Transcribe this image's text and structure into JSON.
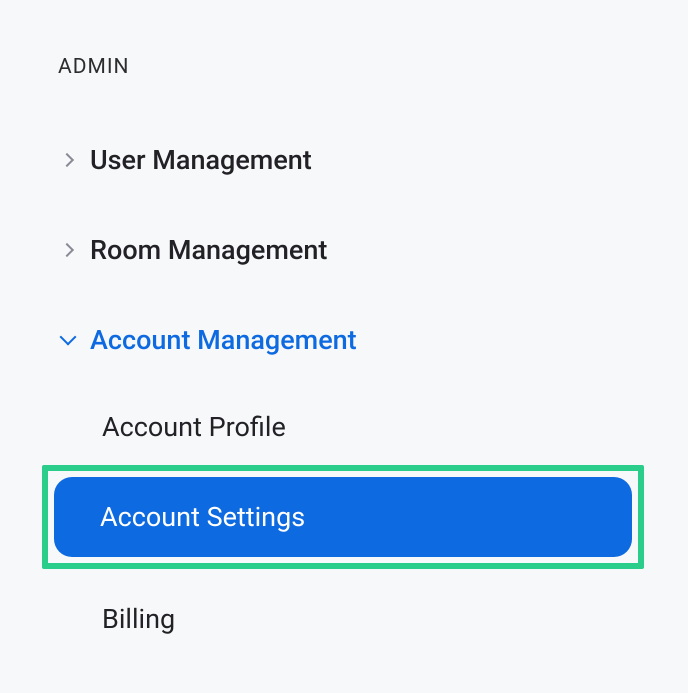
{
  "section": {
    "header": "ADMIN"
  },
  "nav": {
    "items": [
      {
        "label": "User Management",
        "expanded": false
      },
      {
        "label": "Room Management",
        "expanded": false
      },
      {
        "label": "Account Management",
        "expanded": true,
        "children": [
          {
            "label": "Account Profile",
            "active": false,
            "highlighted": false
          },
          {
            "label": "Account Settings",
            "active": true,
            "highlighted": true
          },
          {
            "label": "Billing",
            "active": false,
            "highlighted": false
          }
        ]
      }
    ]
  },
  "colors": {
    "accent": "#0e6ae0",
    "highlight_border": "#2bcd8a",
    "text": "#222226",
    "text_muted": "#888a95",
    "background": "#f7f8fa"
  }
}
